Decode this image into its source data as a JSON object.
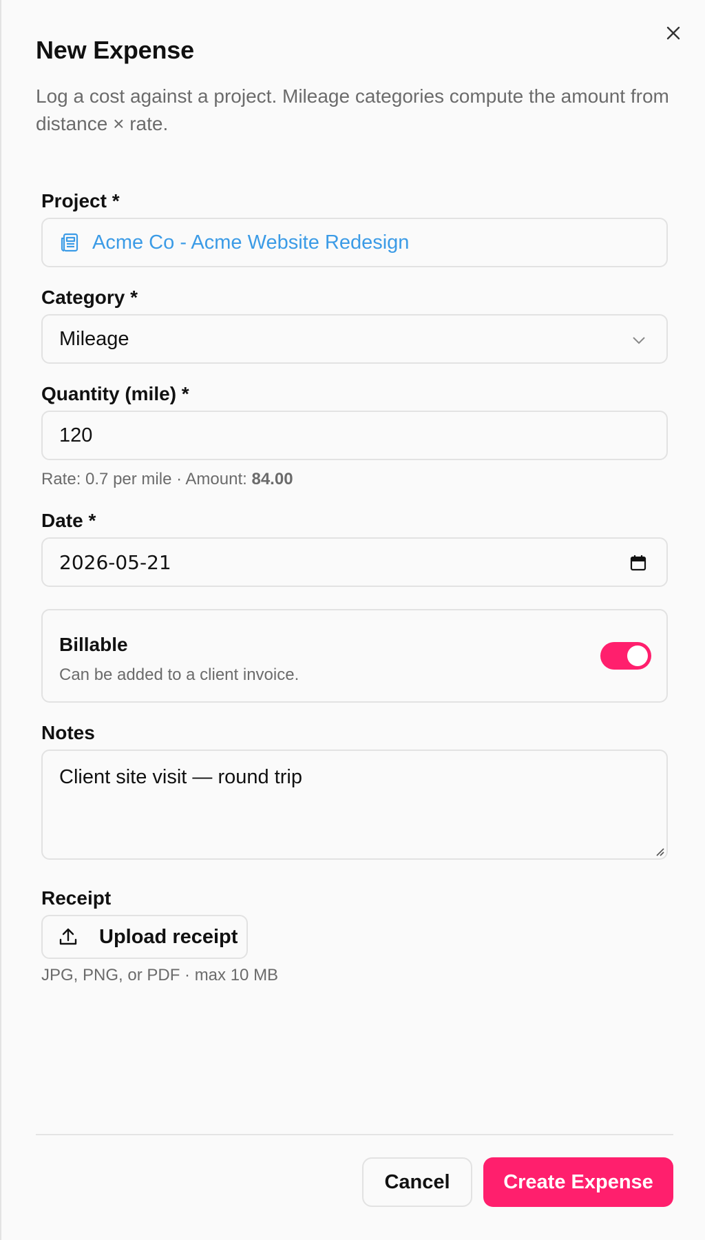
{
  "dialog": {
    "title": "New Expense",
    "description": "Log a cost against a project. Mileage categories compute the amount from distance × rate."
  },
  "project": {
    "label": "Project *",
    "value": "Acme Co - Acme Website Redesign"
  },
  "category": {
    "label": "Category *",
    "value": "Mileage"
  },
  "quantity": {
    "label": "Quantity (mile) *",
    "value": "120",
    "hint_prefix": "Rate: 0.7 per mile · Amount: ",
    "hint_amount": "84.00"
  },
  "date": {
    "label": "Date *",
    "value": "2026-05-21"
  },
  "billable": {
    "title": "Billable",
    "subtitle": "Can be added to a client invoice.",
    "enabled": true
  },
  "notes": {
    "label": "Notes",
    "value": "Client site visit — round trip"
  },
  "receipt": {
    "label": "Receipt",
    "button_label": "Upload receipt",
    "hint": "JPG, PNG, or PDF · max 10 MB"
  },
  "footer": {
    "cancel_label": "Cancel",
    "create_label": "Create Expense"
  },
  "colors": {
    "accent": "#ff1f6d",
    "link": "#3b9be6"
  },
  "icons": [
    "close-icon",
    "project-icon",
    "chevron-down-icon",
    "calendar-icon",
    "upload-icon",
    "resize-handle-icon"
  ]
}
